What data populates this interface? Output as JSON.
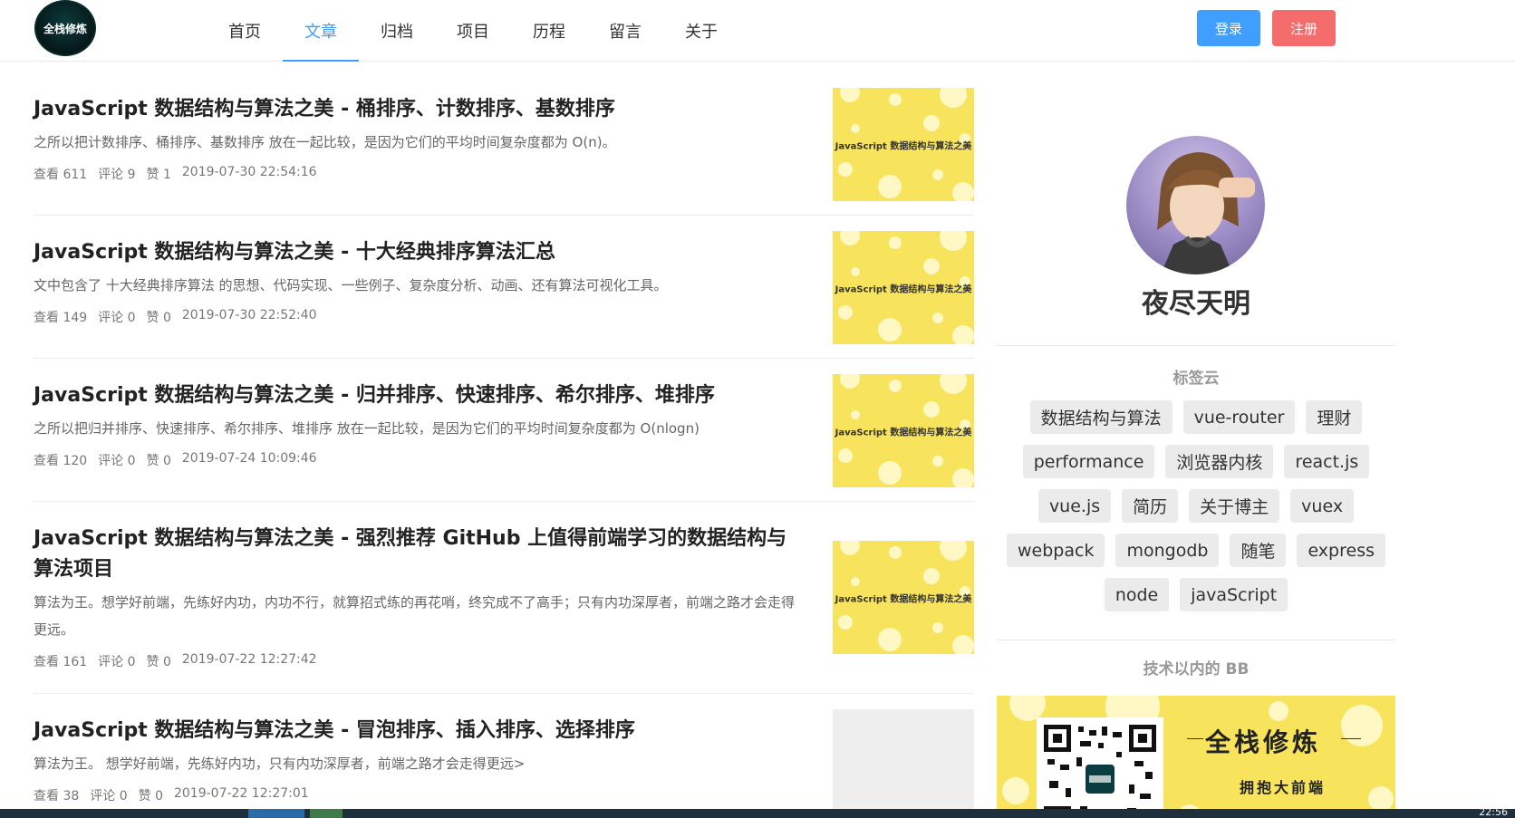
{
  "header": {
    "logo_text": "全栈修炼",
    "nav": [
      "首页",
      "文章",
      "归档",
      "项目",
      "历程",
      "留言",
      "关于"
    ],
    "active_nav": "文章",
    "login": "登录",
    "register": "注册"
  },
  "thumb_text": "JavaScript 数据结构与算法之美",
  "articles": [
    {
      "title": "JavaScript 数据结构与算法之美 - 桶排序、计数排序、基数排序",
      "desc": "之所以把计数排序、桶排序、基数排序 放在一起比较，是因为它们的平均时间复杂度都为 O(n)。",
      "views": "查看 611",
      "comments": "评论 9",
      "likes": "赞 1",
      "date": "2019-07-30 22:54:16"
    },
    {
      "title": "JavaScript 数据结构与算法之美 - 十大经典排序算法汇总",
      "desc": "文中包含了 十大经典排序算法 的思想、代码实现、一些例子、复杂度分析、动画、还有算法可视化工具。",
      "views": "查看 149",
      "comments": "评论 0",
      "likes": "赞 0",
      "date": "2019-07-30 22:52:40"
    },
    {
      "title": "JavaScript 数据结构与算法之美 - 归并排序、快速排序、希尔排序、堆排序",
      "desc": "之所以把归并排序、快速排序、希尔排序、堆排序 放在一起比较，是因为它们的平均时间复杂度都为 O(nlogn)",
      "views": "查看 120",
      "comments": "评论 0",
      "likes": "赞 0",
      "date": "2019-07-24 10:09:46"
    },
    {
      "title": "JavaScript 数据结构与算法之美 - 强烈推荐 GitHub 上值得前端学习的数据结构与算法项目",
      "desc": "算法为王。想学好前端，先练好内功，内功不行，就算招式练的再花哨，终究成不了高手；只有内功深厚者，前端之路才会走得更远。",
      "views": "查看 161",
      "comments": "评论 0",
      "likes": "赞 0",
      "date": "2019-07-22 12:27:42"
    },
    {
      "title": "JavaScript 数据结构与算法之美 - 冒泡排序、插入排序、选择排序",
      "desc": "算法为王。 想学好前端，先练好内功，只有内功深厚者，前端之路才会走得更远>",
      "views": "查看 38",
      "comments": "评论 0",
      "likes": "赞 0",
      "date": "2019-07-22 12:27:01"
    }
  ],
  "sidebar": {
    "author": "夜尽天明",
    "tags_title": "标签云",
    "tag_rows": [
      [
        "数据结构与算法",
        "vue-router",
        "理财"
      ],
      [
        "performance",
        "浏览器内核",
        "react.js"
      ],
      [
        "vue.js",
        "简历",
        "关于博主",
        "vuex"
      ],
      [
        "webpack",
        "mongodb",
        "随笔",
        "express"
      ],
      [
        "node",
        "javaScript"
      ]
    ],
    "bb_title": "技术以内的 BB",
    "promo_title": "全栈修炼",
    "promo_sub": "拥抱大前端"
  },
  "taskbar": {
    "clock": "22:56"
  },
  "colors": {
    "primary": "#409eff",
    "danger": "#f56c6c",
    "thumb_yellow": "#f7e35c"
  }
}
